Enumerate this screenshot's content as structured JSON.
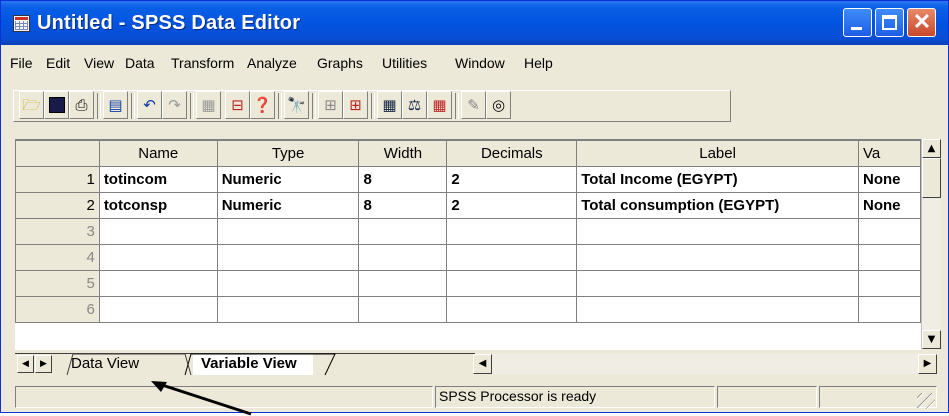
{
  "window": {
    "title": "Untitled - SPSS Data Editor"
  },
  "menu": [
    "File",
    "Edit",
    "View",
    "Data",
    "Transform",
    "Analyze",
    "Graphs",
    "Utilities",
    "Window",
    "Help"
  ],
  "toolbar": [
    "open-folder-icon",
    "save-disk-icon",
    "print-icon",
    "dialog-recall-icon",
    "undo-icon",
    "redo-icon",
    "goto-chart-icon",
    "goto-case-icon",
    "variables-icon",
    "find-icon",
    "insert-case-icon",
    "insert-variable-icon",
    "split-file-icon",
    "weight-cases-icon",
    "select-cases-icon",
    "value-labels-icon",
    "use-sets-icon"
  ],
  "grid": {
    "columns": [
      "Name",
      "Type",
      "Width",
      "Decimals",
      "Label",
      "Va"
    ],
    "rows": [
      {
        "n": "1",
        "cells": [
          "totincom",
          "Numeric",
          "8",
          "2",
          "Total Income (EGYPT)",
          "None"
        ]
      },
      {
        "n": "2",
        "cells": [
          "totconsp",
          "Numeric",
          "8",
          "2",
          "Total consumption (EGYPT)",
          "None"
        ]
      },
      {
        "n": "3",
        "cells": [
          "",
          "",
          "",
          "",
          "",
          ""
        ]
      },
      {
        "n": "4",
        "cells": [
          "",
          "",
          "",
          "",
          "",
          ""
        ]
      },
      {
        "n": "5",
        "cells": [
          "",
          "",
          "",
          "",
          "",
          ""
        ]
      },
      {
        "n": "6",
        "cells": [
          "",
          "",
          "",
          "",
          "",
          ""
        ]
      }
    ]
  },
  "tabs": {
    "data_view": "Data View",
    "variable_view": "Variable View"
  },
  "status": "SPSS Processor  is ready",
  "colors": {
    "title_blue": "#0054e3",
    "chrome": "#ece9d8"
  }
}
